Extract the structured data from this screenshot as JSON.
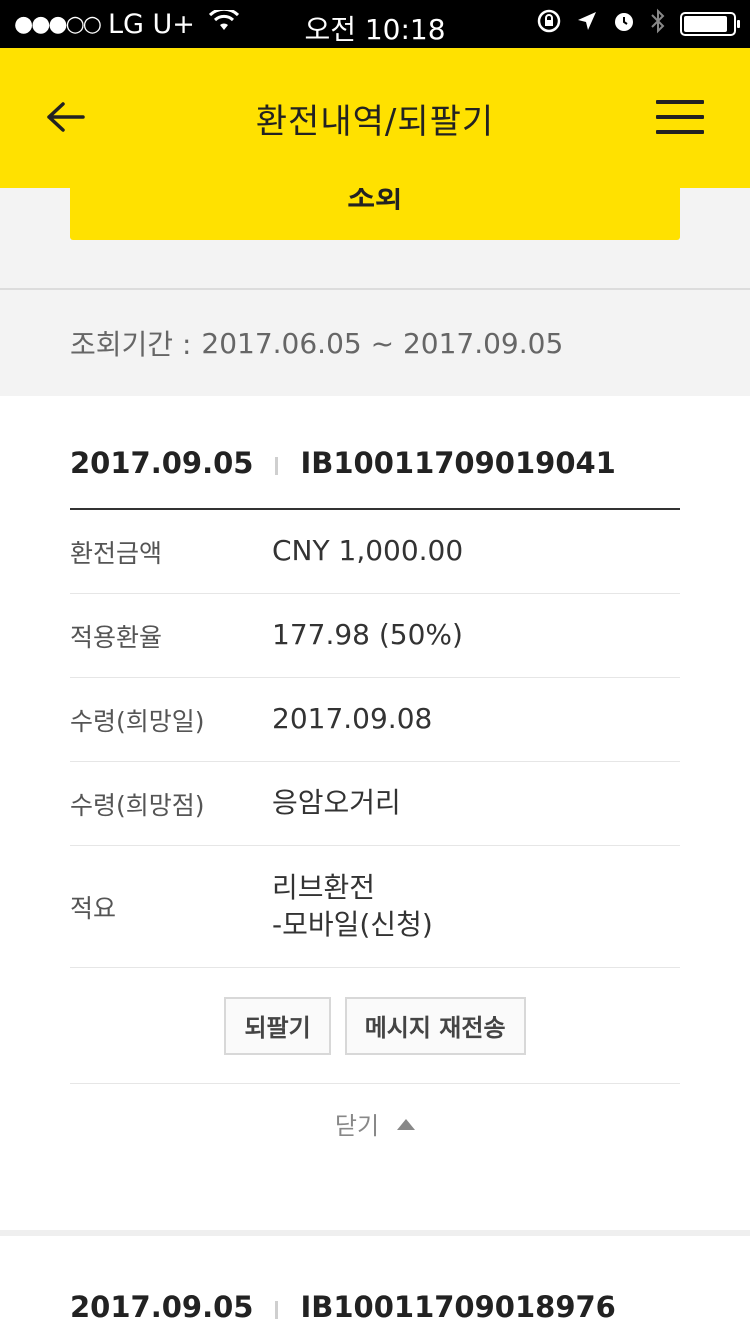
{
  "status_bar": {
    "signal": "●●●○○",
    "carrier": "LG U+",
    "time": "오전 10:18",
    "battery_level": 0.9
  },
  "nav": {
    "title": "환전내역/되팔기"
  },
  "search": {
    "button_label": "조회"
  },
  "period": {
    "label": "조회기간 :",
    "value": "2017.06.05 ~ 2017.09.05"
  },
  "records": [
    {
      "date": "2017.09.05",
      "id": "IB10011709019041",
      "rows": [
        {
          "key": "환전금액",
          "value": "CNY 1,000.00"
        },
        {
          "key": "적용환율",
          "value": "177.98 (50%)"
        },
        {
          "key": "수령(희망일)",
          "value": "2017.09.08"
        },
        {
          "key": "수령(희망점)",
          "value": "응암오거리"
        },
        {
          "key": "적요",
          "value_line1": "리브환전",
          "value_line2": "-모바일(신청)"
        }
      ],
      "actions": {
        "resell": "되팔기",
        "resend": "메시지 재전송"
      },
      "close_label": "닫기"
    },
    {
      "date": "2017.09.05",
      "id": "IB10011709018976"
    }
  ],
  "colors": {
    "accent": "#ffe100",
    "background": "#f3f3f3"
  }
}
